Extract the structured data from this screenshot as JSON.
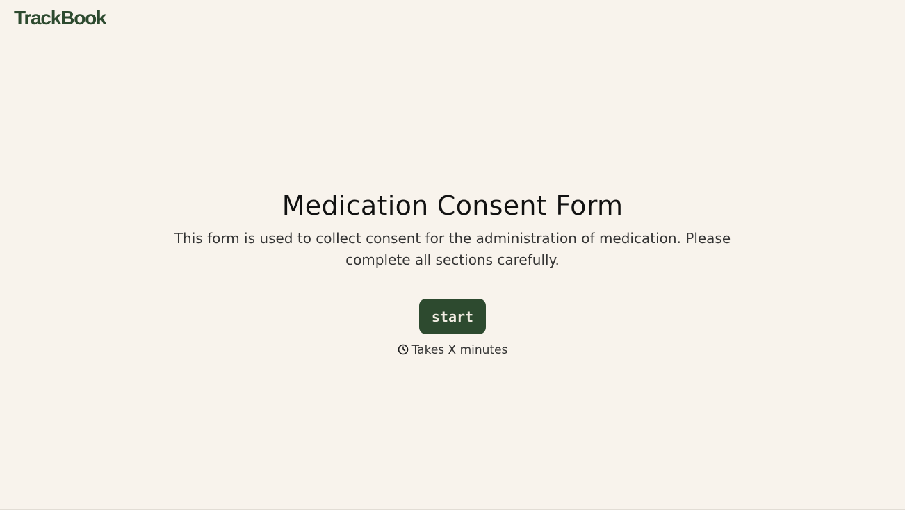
{
  "header": {
    "logo_text": "TrackBook"
  },
  "form": {
    "title": "Medication Consent Form",
    "description": "This form is used to collect consent for the administration of medication. Please complete all sections carefully.",
    "start_label": "start",
    "duration_text": "Takes X minutes",
    "duration_icon": "clock-icon"
  },
  "colors": {
    "background": "#f8f3ec",
    "brand": "#2d4a2f",
    "button_text": "#f1ece2"
  }
}
